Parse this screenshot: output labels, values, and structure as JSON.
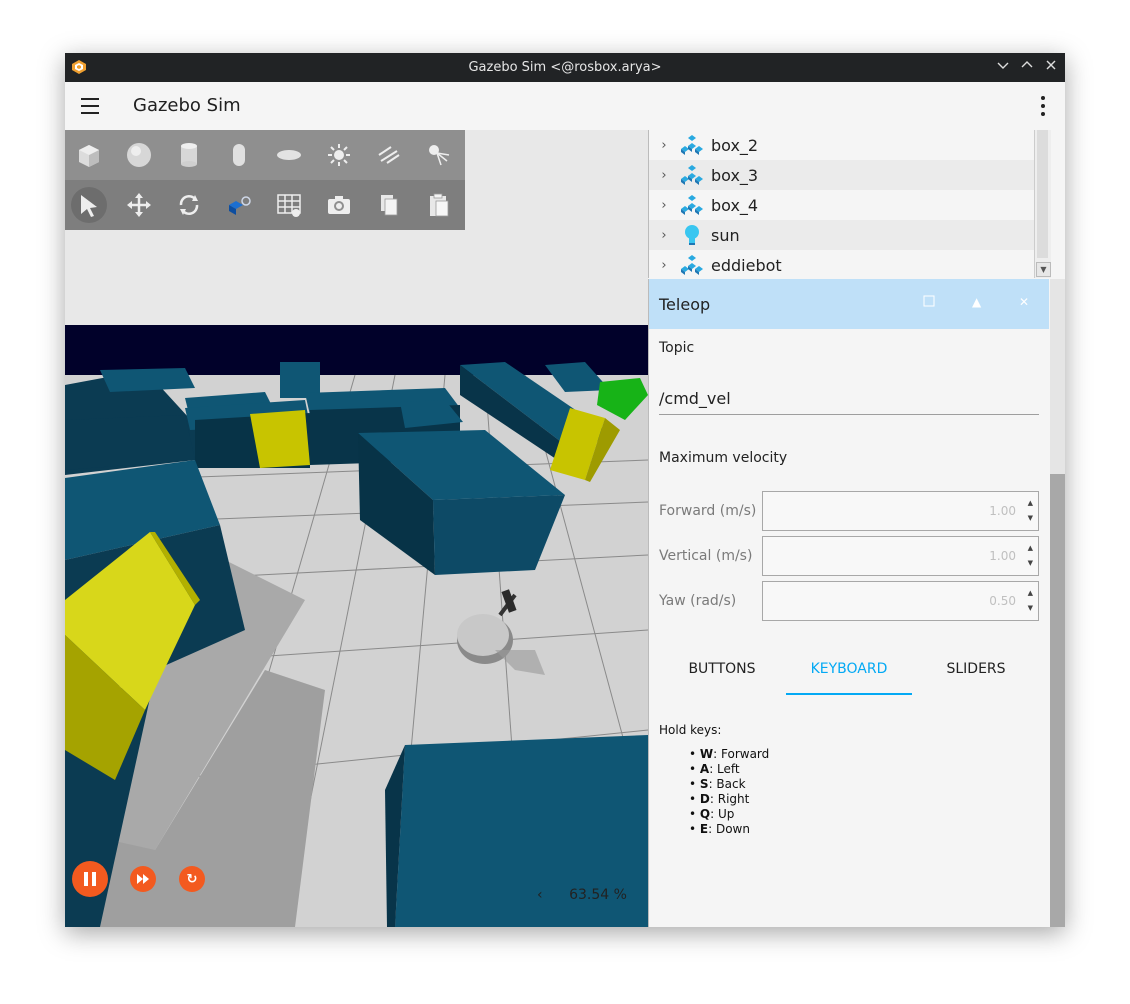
{
  "window": {
    "title": "Gazebo Sim <@rosbox.arya>"
  },
  "appbar": {
    "title": "Gazebo Sim"
  },
  "toolbar": {
    "shapes": [
      "box-icon",
      "sphere-icon",
      "cylinder-icon",
      "capsule-icon",
      "ellipsoid-icon",
      "point-light-icon",
      "directional-light-icon",
      "spot-light-icon"
    ],
    "transforms": [
      "select-icon",
      "translate-icon",
      "rotate-icon",
      "view-angle-icon",
      "grid-snap-icon",
      "screenshot-icon",
      "copy-icon",
      "paste-icon"
    ]
  },
  "entity_tree": {
    "items": [
      {
        "label": "box_2",
        "icon": "model-icon"
      },
      {
        "label": "box_3",
        "icon": "model-icon"
      },
      {
        "label": "box_4",
        "icon": "model-icon"
      },
      {
        "label": "sun",
        "icon": "light-icon"
      },
      {
        "label": "eddiebot",
        "icon": "model-icon"
      }
    ]
  },
  "teleop": {
    "title": "Teleop",
    "topic_label": "Topic",
    "topic_value": "/cmd_vel",
    "max_velocity_label": "Maximum velocity",
    "fields": [
      {
        "label": "Forward (m/s)",
        "value": "1.00"
      },
      {
        "label": "Vertical (m/s)",
        "value": "1.00"
      },
      {
        "label": "Yaw (rad/s)",
        "value": "0.50"
      }
    ],
    "tabs": [
      "BUTTONS",
      "KEYBOARD",
      "SLIDERS"
    ],
    "active_tab": "KEYBOARD",
    "hold_keys_label": "Hold keys:",
    "keys": [
      {
        "key": "W",
        "action": ": Forward"
      },
      {
        "key": "A",
        "action": ": Left"
      },
      {
        "key": "S",
        "action": ": Back"
      },
      {
        "key": "D",
        "action": ": Right"
      },
      {
        "key": "Q",
        "action": ": Up"
      },
      {
        "key": "E",
        "action": ": Down"
      }
    ]
  },
  "playback": {
    "rtf_chevron": "‹",
    "real_time_factor": "63.54 %"
  },
  "colors": {
    "accent": "#03a9f4",
    "play_button": "#f35a1f",
    "teleop_header": "#bfe0f8",
    "wall": "#0e4c66",
    "yellow_block": "#c8c400"
  }
}
